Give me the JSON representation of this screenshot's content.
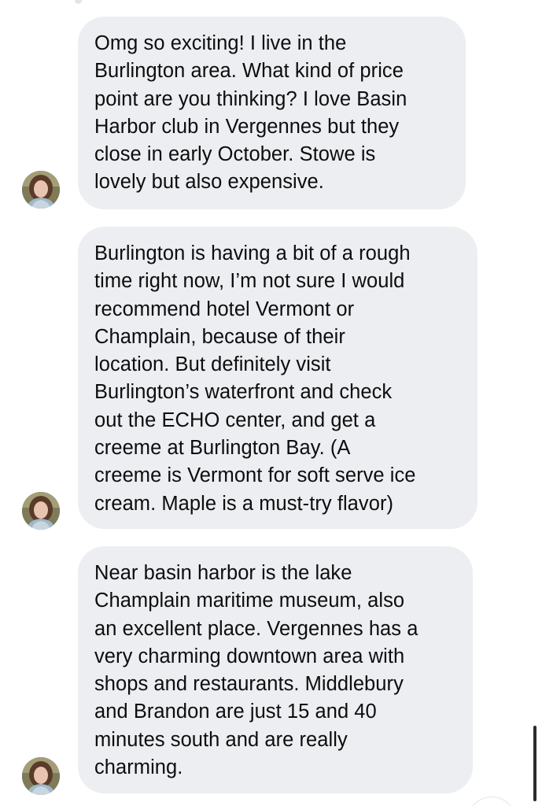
{
  "messages": [
    {
      "sender": "other",
      "avatar_icon": "user-avatar-icon",
      "text": "Omg so exciting! I live in the\nBurlington area. What kind of price\npoint are you thinking?  I love Basin\nHarbor club in Vergennes but they\nclose in early October. Stowe is\nlovely but also expensive."
    },
    {
      "sender": "other",
      "avatar_icon": "user-avatar-icon",
      "text": "Burlington is having a bit of a rough\ntime right now, I’m not sure I would\nrecommend hotel Vermont or\nChamplain, because of their\nlocation. But definitely visit\nBurlington’s waterfront and check\nout the ECHO center, and get a\ncreeme at Burlington Bay. (A\ncreeme is Vermont for soft serve ice\ncream. Maple is a must-try flavor)"
    },
    {
      "sender": "other",
      "avatar_icon": "user-avatar-icon",
      "text": "Near basin harbor is the lake\nChamplain maritime museum, also\nan excellent place. Vergennes has a\nvery charming downtown area with\nshops and restaurants. Middlebury\nand Brandon are just 15 and 40\nminutes south and are really\ncharming."
    }
  ],
  "colors": {
    "bubble_background": "#eceef1",
    "text": "#0d0d0d",
    "background": "#ffffff"
  }
}
